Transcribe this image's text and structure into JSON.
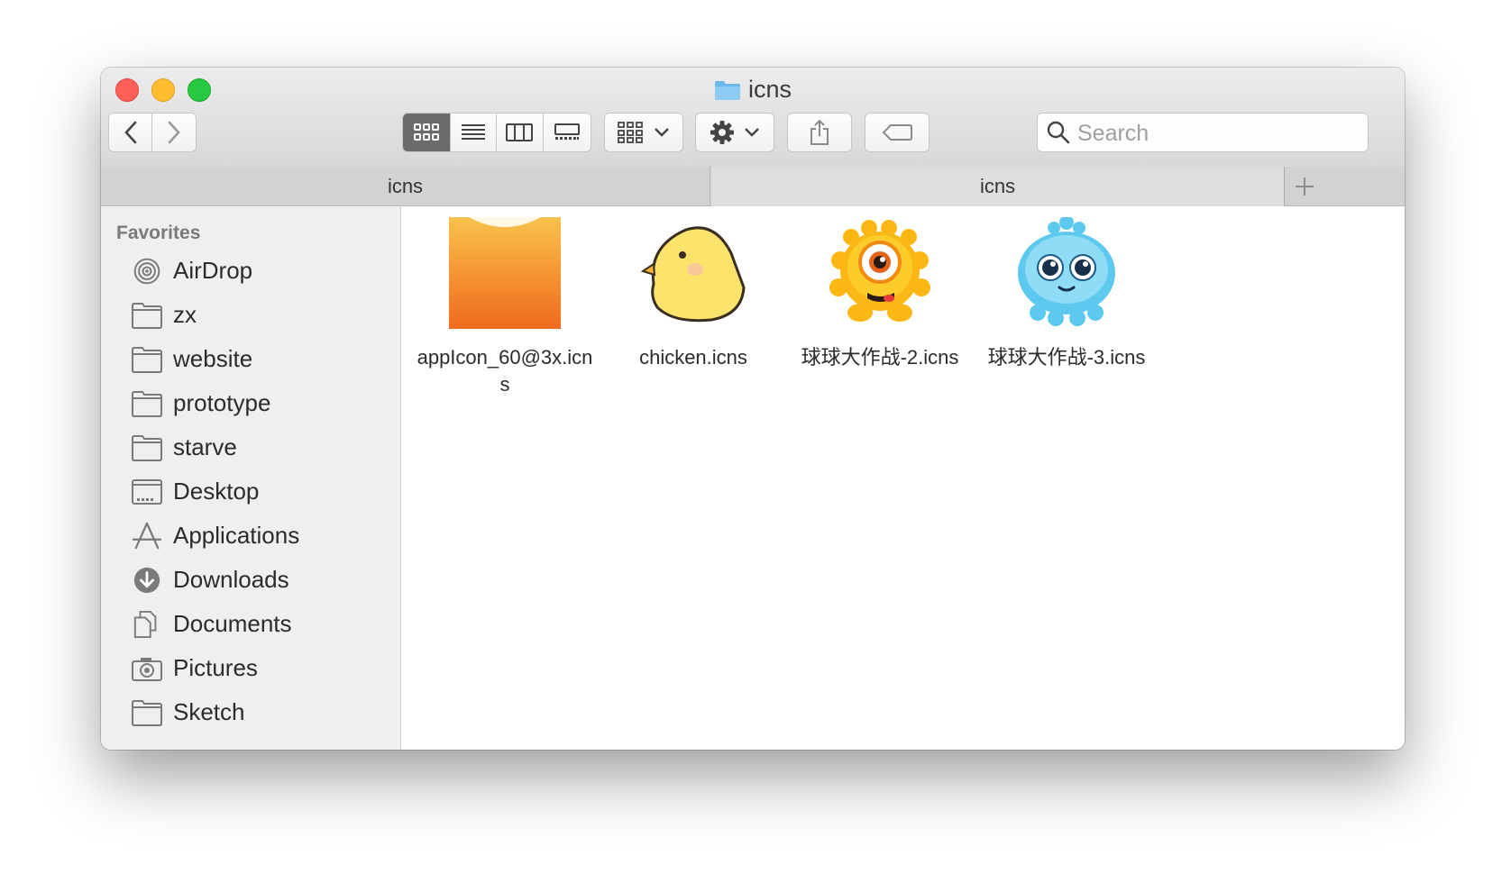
{
  "window": {
    "title": "icns"
  },
  "toolbar": {
    "back_icon": "chevron-left-icon",
    "forward_icon": "chevron-right-icon",
    "view_modes": [
      "icon-view-icon",
      "list-view-icon",
      "column-view-icon",
      "gallery-view-icon"
    ],
    "selected_view": "icon-view-icon",
    "group_icon": "grid-group-icon",
    "action_icon": "gear-icon",
    "share_icon": "share-icon",
    "tag_icon": "tag-icon",
    "search_placeholder": "Search"
  },
  "tabs": [
    {
      "label": "icns",
      "active": true
    },
    {
      "label": "icns",
      "active": false
    }
  ],
  "sidebar": {
    "heading": "Favorites",
    "items": [
      {
        "label": "AirDrop",
        "icon": "airdrop-icon"
      },
      {
        "label": "zx",
        "icon": "folder-icon"
      },
      {
        "label": "website",
        "icon": "folder-icon"
      },
      {
        "label": "prototype",
        "icon": "folder-icon"
      },
      {
        "label": "starve",
        "icon": "folder-icon"
      },
      {
        "label": "Desktop",
        "icon": "desktop-icon"
      },
      {
        "label": "Applications",
        "icon": "applications-icon"
      },
      {
        "label": "Downloads",
        "icon": "downloads-icon"
      },
      {
        "label": "Documents",
        "icon": "documents-icon"
      },
      {
        "label": "Pictures",
        "icon": "camera-icon"
      },
      {
        "label": "Sketch",
        "icon": "folder-icon"
      }
    ]
  },
  "files": [
    {
      "name": "appIcon_60@3x.icns",
      "icon": "orange-app-icon"
    },
    {
      "name": "chicken.icns",
      "icon": "chicken-icon"
    },
    {
      "name": "球球大作战-2.icns",
      "icon": "orange-monster-icon"
    },
    {
      "name": "球球大作战-3.icns",
      "icon": "blue-monster-icon"
    }
  ],
  "colors": {
    "close": "#fe5f57",
    "minimize": "#febc2e",
    "zoom": "#28c840",
    "folder_blue": "#6cb8ec",
    "selected_segment": "#6b6b6b"
  }
}
